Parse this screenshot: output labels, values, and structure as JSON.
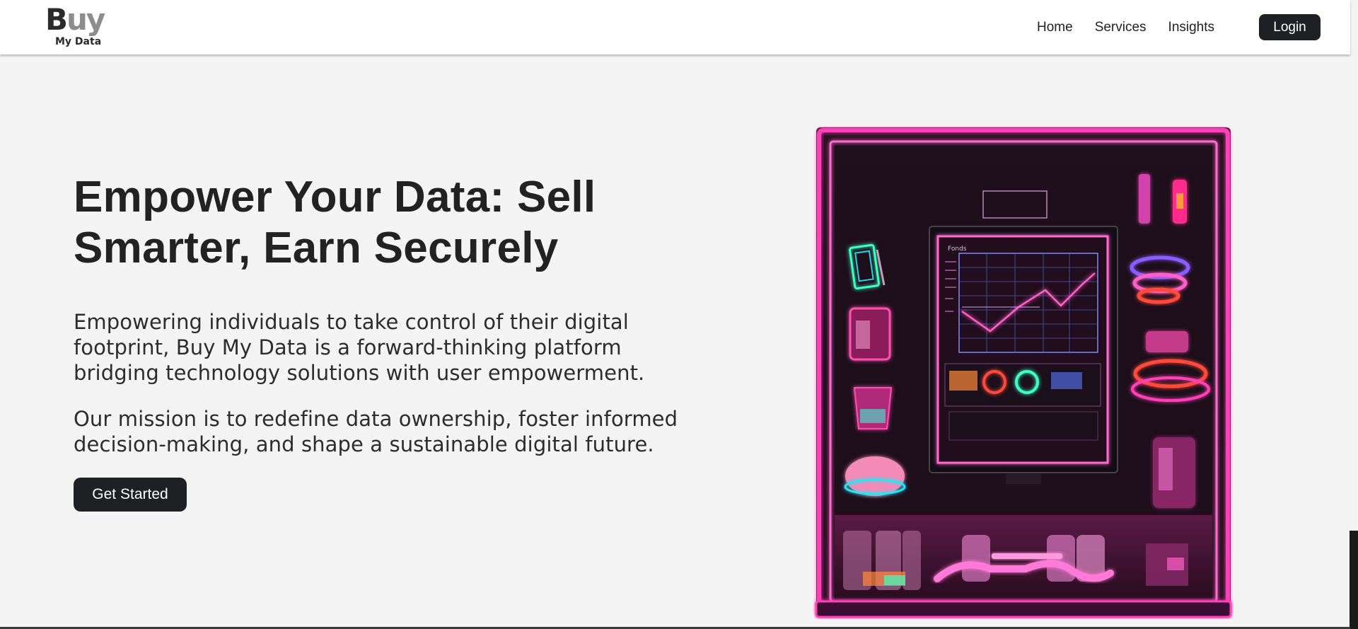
{
  "header": {
    "logo": {
      "big_first": "B",
      "big_rest": "uy",
      "small": "My Data"
    },
    "nav": [
      {
        "label": "Home"
      },
      {
        "label": "Services"
      },
      {
        "label": "Insights"
      }
    ],
    "login_label": "Login"
  },
  "hero": {
    "title_line1": "Empower Your Data: Sell",
    "title_line2": "Smarter, Earn Securely",
    "paragraph1": "Empowering individuals to take control of their digital footprint, Buy My Data is a forward-thinking platform bridging technology solutions with user empowerment.",
    "paragraph2": "Our mission is to redefine data ownership, foster informed decision-making, and shape a sustainable digital future.",
    "cta_label": "Get Started"
  },
  "illustration": {
    "screen_label": "Fonds",
    "accent": "#ff3fb8",
    "cyan": "#23e6f0"
  },
  "colors": {
    "background": "#f4f4f4",
    "header_bg": "#ffffff",
    "button_bg": "#1f2023",
    "text": "#222222"
  }
}
